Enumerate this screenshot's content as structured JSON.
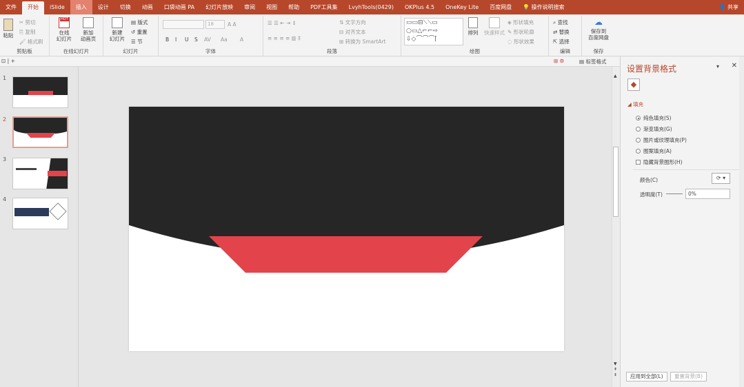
{
  "tabs": [
    "文件",
    "开始",
    "iSlide",
    "插入",
    "设计",
    "切换",
    "动画",
    "口袋动画 PA",
    "幻灯片放映",
    "审阅",
    "视图",
    "帮助",
    "PDF工具集",
    "LvyhTools(0429)",
    "OKPlus 4.5",
    "OneKey Lite",
    "百度网盘",
    "操作说明搜索"
  ],
  "share": "共享",
  "ribbon": {
    "clipboard": {
      "paste": "粘贴",
      "cut": "剪切",
      "copy": "复制",
      "format_painter": "格式刷",
      "label": "剪贴板"
    },
    "online": {
      "online_slides": "在线\n幻灯片",
      "new_page": "新加\n动画页",
      "label": "在线幻灯片",
      "badge": "HOT"
    },
    "slides": {
      "new_slide": "新建\n幻灯片",
      "layout": "版式",
      "reset": "重置",
      "section": "节",
      "label": "幻灯片"
    },
    "font": {
      "font_size": "18",
      "label": "字体",
      "bold": "B",
      "italic": "I",
      "underline": "U",
      "strike": "S",
      "spacing": "AV",
      "case": "Aa",
      "color": "A"
    },
    "paragraph": {
      "text_direction": "文字方向",
      "align_text": "对齐文本",
      "smartart": "转换为 SmartArt",
      "label": "段落"
    },
    "drawing": {
      "arrange": "排列",
      "quick_styles": "快速样式",
      "shape_fill": "形状填充",
      "shape_outline": "形状轮廓",
      "shape_effects": "形状效果",
      "label": "绘图"
    },
    "editing": {
      "find": "查找",
      "replace": "替换",
      "select": "选择",
      "label": "编辑"
    },
    "save": {
      "save_to": "保存到\n百度网盘",
      "label": "保存"
    }
  },
  "qbar": {
    "tag_format": "标签格式"
  },
  "thumbnails": [
    {
      "num": "1"
    },
    {
      "num": "2"
    },
    {
      "num": "3"
    },
    {
      "num": "4"
    }
  ],
  "pane": {
    "title": "设置背景格式",
    "section": "填充",
    "options": [
      "纯色填充(S)",
      "渐变填充(G)",
      "图片或纹理填充(P)",
      "图案填充(A)"
    ],
    "hide_bg": "隐藏背景图形(H)",
    "color_label": "颜色(C)",
    "transparency_label": "透明度(T)",
    "transparency_value": "0%",
    "apply_all": "应用到全部(L)",
    "reset_bg": "重置背景(B)"
  },
  "colors": {
    "accent": "#b7472a",
    "slide_dark": "#262626",
    "slide_red": "#e3434b"
  }
}
